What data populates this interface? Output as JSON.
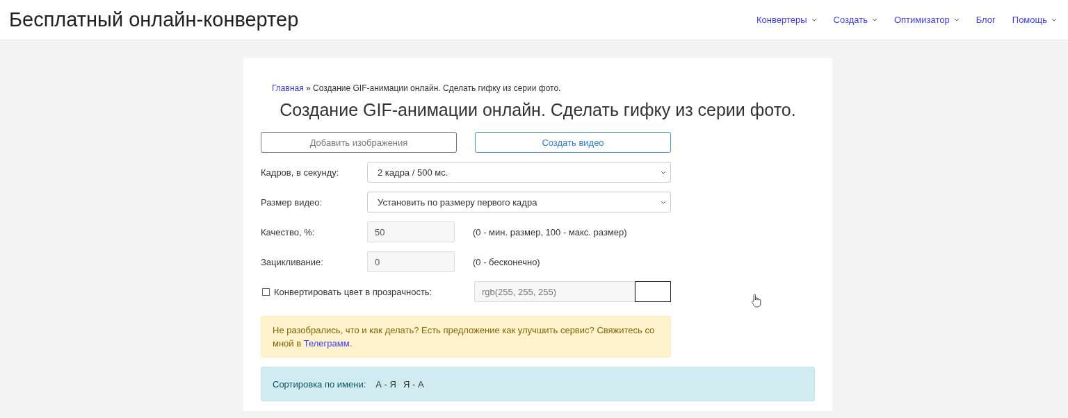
{
  "header": {
    "site_title": "Бесплатный онлайн-конвертер",
    "nav": [
      {
        "label": "Конвертеры",
        "kind": "dropdown"
      },
      {
        "label": "Создать",
        "kind": "dropdown"
      },
      {
        "label": "Оптимизатор",
        "kind": "dropdown"
      },
      {
        "label": "Блог",
        "kind": "link"
      },
      {
        "label": "Помощь",
        "kind": "dropdown"
      }
    ]
  },
  "breadcrumb": {
    "home": "Главная",
    "separator": "»",
    "current": "Создание GIF-анимации онлайн. Сделать гифку из серии фото."
  },
  "page_title": "Создание GIF-анимации онлайн. Сделать гифку из серии фото.",
  "buttons": [
    {
      "label": "Добавить изображения",
      "kind": "secondary"
    },
    {
      "label": "Создать видео",
      "kind": "primary"
    }
  ],
  "form_rows": [
    {
      "kind": "select",
      "label": "Кадров, в секунду:",
      "value": "2 кадра / 500 мс."
    },
    {
      "kind": "select",
      "label": "Размер видео:",
      "value": "Установить по размеру первого кадра"
    },
    {
      "kind": "input",
      "label": "Качество, %:",
      "value": "50",
      "hint": "(0 - мин. размер, 100 - макс. размер)"
    },
    {
      "kind": "input",
      "label": "Зацикливание:",
      "value": "0",
      "hint": "(0 - бесконечно)"
    }
  ],
  "transparency": {
    "label": "Конвертировать цвет в прозрачность:",
    "checked": false,
    "color_value": "rgb(255, 255, 255)"
  },
  "notice": {
    "text": "Не разобрались, что и как делать? Есть предложение как улучшить сервис? Свяжитесь со мной в ",
    "link": "Телеграмм",
    "end": "."
  },
  "sort": {
    "label": "Сортировка по имени:",
    "options": [
      {
        "label": "А - Я"
      },
      {
        "label": "Я - А"
      }
    ]
  }
}
